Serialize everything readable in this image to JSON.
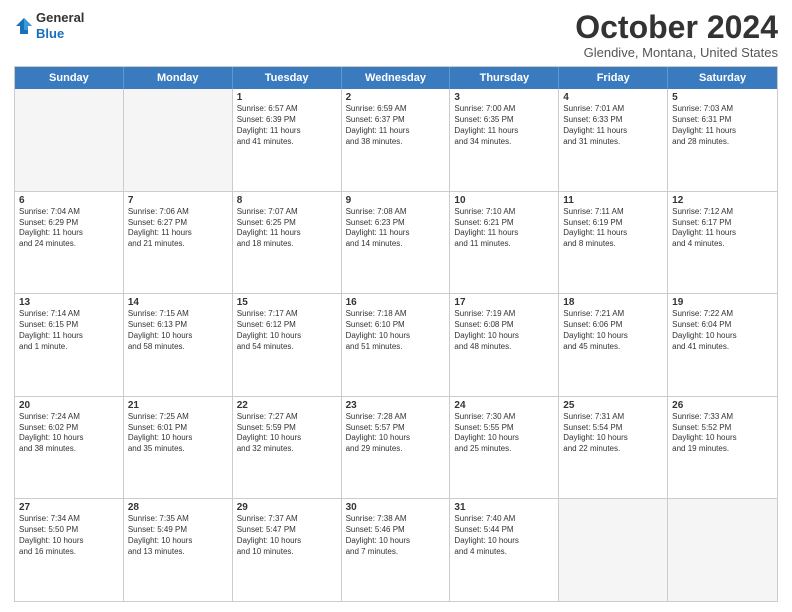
{
  "header": {
    "logo_line1": "General",
    "logo_line2": "Blue",
    "month_title": "October 2024",
    "location": "Glendive, Montana, United States"
  },
  "days_of_week": [
    "Sunday",
    "Monday",
    "Tuesday",
    "Wednesday",
    "Thursday",
    "Friday",
    "Saturday"
  ],
  "rows": [
    [
      {
        "day": "",
        "lines": [],
        "empty": true
      },
      {
        "day": "",
        "lines": [],
        "empty": true
      },
      {
        "day": "1",
        "lines": [
          "Sunrise: 6:57 AM",
          "Sunset: 6:39 PM",
          "Daylight: 11 hours",
          "and 41 minutes."
        ],
        "empty": false
      },
      {
        "day": "2",
        "lines": [
          "Sunrise: 6:59 AM",
          "Sunset: 6:37 PM",
          "Daylight: 11 hours",
          "and 38 minutes."
        ],
        "empty": false
      },
      {
        "day": "3",
        "lines": [
          "Sunrise: 7:00 AM",
          "Sunset: 6:35 PM",
          "Daylight: 11 hours",
          "and 34 minutes."
        ],
        "empty": false
      },
      {
        "day": "4",
        "lines": [
          "Sunrise: 7:01 AM",
          "Sunset: 6:33 PM",
          "Daylight: 11 hours",
          "and 31 minutes."
        ],
        "empty": false
      },
      {
        "day": "5",
        "lines": [
          "Sunrise: 7:03 AM",
          "Sunset: 6:31 PM",
          "Daylight: 11 hours",
          "and 28 minutes."
        ],
        "empty": false
      }
    ],
    [
      {
        "day": "6",
        "lines": [
          "Sunrise: 7:04 AM",
          "Sunset: 6:29 PM",
          "Daylight: 11 hours",
          "and 24 minutes."
        ],
        "empty": false
      },
      {
        "day": "7",
        "lines": [
          "Sunrise: 7:06 AM",
          "Sunset: 6:27 PM",
          "Daylight: 11 hours",
          "and 21 minutes."
        ],
        "empty": false
      },
      {
        "day": "8",
        "lines": [
          "Sunrise: 7:07 AM",
          "Sunset: 6:25 PM",
          "Daylight: 11 hours",
          "and 18 minutes."
        ],
        "empty": false
      },
      {
        "day": "9",
        "lines": [
          "Sunrise: 7:08 AM",
          "Sunset: 6:23 PM",
          "Daylight: 11 hours",
          "and 14 minutes."
        ],
        "empty": false
      },
      {
        "day": "10",
        "lines": [
          "Sunrise: 7:10 AM",
          "Sunset: 6:21 PM",
          "Daylight: 11 hours",
          "and 11 minutes."
        ],
        "empty": false
      },
      {
        "day": "11",
        "lines": [
          "Sunrise: 7:11 AM",
          "Sunset: 6:19 PM",
          "Daylight: 11 hours",
          "and 8 minutes."
        ],
        "empty": false
      },
      {
        "day": "12",
        "lines": [
          "Sunrise: 7:12 AM",
          "Sunset: 6:17 PM",
          "Daylight: 11 hours",
          "and 4 minutes."
        ],
        "empty": false
      }
    ],
    [
      {
        "day": "13",
        "lines": [
          "Sunrise: 7:14 AM",
          "Sunset: 6:15 PM",
          "Daylight: 11 hours",
          "and 1 minute."
        ],
        "empty": false
      },
      {
        "day": "14",
        "lines": [
          "Sunrise: 7:15 AM",
          "Sunset: 6:13 PM",
          "Daylight: 10 hours",
          "and 58 minutes."
        ],
        "empty": false
      },
      {
        "day": "15",
        "lines": [
          "Sunrise: 7:17 AM",
          "Sunset: 6:12 PM",
          "Daylight: 10 hours",
          "and 54 minutes."
        ],
        "empty": false
      },
      {
        "day": "16",
        "lines": [
          "Sunrise: 7:18 AM",
          "Sunset: 6:10 PM",
          "Daylight: 10 hours",
          "and 51 minutes."
        ],
        "empty": false
      },
      {
        "day": "17",
        "lines": [
          "Sunrise: 7:19 AM",
          "Sunset: 6:08 PM",
          "Daylight: 10 hours",
          "and 48 minutes."
        ],
        "empty": false
      },
      {
        "day": "18",
        "lines": [
          "Sunrise: 7:21 AM",
          "Sunset: 6:06 PM",
          "Daylight: 10 hours",
          "and 45 minutes."
        ],
        "empty": false
      },
      {
        "day": "19",
        "lines": [
          "Sunrise: 7:22 AM",
          "Sunset: 6:04 PM",
          "Daylight: 10 hours",
          "and 41 minutes."
        ],
        "empty": false
      }
    ],
    [
      {
        "day": "20",
        "lines": [
          "Sunrise: 7:24 AM",
          "Sunset: 6:02 PM",
          "Daylight: 10 hours",
          "and 38 minutes."
        ],
        "empty": false
      },
      {
        "day": "21",
        "lines": [
          "Sunrise: 7:25 AM",
          "Sunset: 6:01 PM",
          "Daylight: 10 hours",
          "and 35 minutes."
        ],
        "empty": false
      },
      {
        "day": "22",
        "lines": [
          "Sunrise: 7:27 AM",
          "Sunset: 5:59 PM",
          "Daylight: 10 hours",
          "and 32 minutes."
        ],
        "empty": false
      },
      {
        "day": "23",
        "lines": [
          "Sunrise: 7:28 AM",
          "Sunset: 5:57 PM",
          "Daylight: 10 hours",
          "and 29 minutes."
        ],
        "empty": false
      },
      {
        "day": "24",
        "lines": [
          "Sunrise: 7:30 AM",
          "Sunset: 5:55 PM",
          "Daylight: 10 hours",
          "and 25 minutes."
        ],
        "empty": false
      },
      {
        "day": "25",
        "lines": [
          "Sunrise: 7:31 AM",
          "Sunset: 5:54 PM",
          "Daylight: 10 hours",
          "and 22 minutes."
        ],
        "empty": false
      },
      {
        "day": "26",
        "lines": [
          "Sunrise: 7:33 AM",
          "Sunset: 5:52 PM",
          "Daylight: 10 hours",
          "and 19 minutes."
        ],
        "empty": false
      }
    ],
    [
      {
        "day": "27",
        "lines": [
          "Sunrise: 7:34 AM",
          "Sunset: 5:50 PM",
          "Daylight: 10 hours",
          "and 16 minutes."
        ],
        "empty": false
      },
      {
        "day": "28",
        "lines": [
          "Sunrise: 7:35 AM",
          "Sunset: 5:49 PM",
          "Daylight: 10 hours",
          "and 13 minutes."
        ],
        "empty": false
      },
      {
        "day": "29",
        "lines": [
          "Sunrise: 7:37 AM",
          "Sunset: 5:47 PM",
          "Daylight: 10 hours",
          "and 10 minutes."
        ],
        "empty": false
      },
      {
        "day": "30",
        "lines": [
          "Sunrise: 7:38 AM",
          "Sunset: 5:46 PM",
          "Daylight: 10 hours",
          "and 7 minutes."
        ],
        "empty": false
      },
      {
        "day": "31",
        "lines": [
          "Sunrise: 7:40 AM",
          "Sunset: 5:44 PM",
          "Daylight: 10 hours",
          "and 4 minutes."
        ],
        "empty": false
      },
      {
        "day": "",
        "lines": [],
        "empty": true
      },
      {
        "day": "",
        "lines": [],
        "empty": true
      }
    ]
  ]
}
